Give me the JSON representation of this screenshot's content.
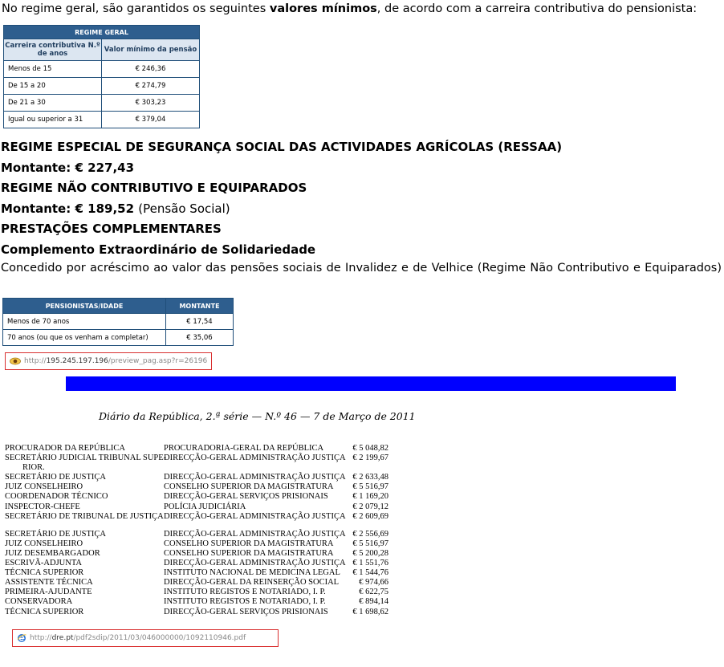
{
  "intro": {
    "before": "No regime geral, são garantidos os seguintes ",
    "bold": "valores mínimos",
    "after": ", de acordo com a carreira contributiva do pensionista:"
  },
  "table1": {
    "caption": "REGIME GERAL",
    "col1": "Carreira contributiva N.º de anos",
    "col2": "Valor mínimo da pensão",
    "rows": [
      {
        "years": "Menos de 15",
        "value": "€ 246,36"
      },
      {
        "years": "De 15 a 20",
        "value": "€ 274,79"
      },
      {
        "years": "De 21 a 30",
        "value": "€ 303,23"
      },
      {
        "years": "Igual ou superior a 31",
        "value": "€ 379,04"
      }
    ]
  },
  "ressaa": {
    "title": "REGIME ESPECIAL DE SEGURANÇA SOCIAL DAS ACTIVIDADES AGRÍCOLAS (RESSAA)",
    "label": "Montante:",
    "amount": "€ 227,43"
  },
  "nao_contrib": {
    "title": "REGIME NÃO CONTRIBUTIVO E EQUIPARADOS",
    "label": "Montante:",
    "amount": "€ 189,52",
    "note": "(Pensão Social)"
  },
  "prestacoes": {
    "title": "PRESTAÇÕES COMPLEMENTARES",
    "subtitle": "Complemento Extraordinário de Solidariedade",
    "text": "Concedido por acréscimo ao valor das pensões sociais de Invalidez e de Velhice (Regime Não Contributivo e Equiparados)"
  },
  "table2": {
    "col1": "PENSIONISTAS/IDADE",
    "col2": "MONTANTE",
    "rows": [
      {
        "age": "Menos de 70 anos",
        "amount": "€ 17,54"
      },
      {
        "age": "70 anos (ou que os venham a completar)",
        "amount": "€ 35,06"
      }
    ]
  },
  "url1": {
    "scheme": "http://",
    "host": "195.245.197.196",
    "path": "/preview_pag.asp?r=26196",
    "icon": "eye-icon"
  },
  "diario": {
    "title": "Diário da República, 2.ª série — N.º 46 — 7  de  Março  de  2011",
    "group1": [
      {
        "cargo": "PROCURADOR DA REPÚBLICA",
        "orgao": "PROCURADORIA-GERAL DA REPÚBLICA",
        "valor": "€ 5 048,82"
      },
      {
        "cargo": "SECRETÁRIO JUDICIAL TRIBUNAL SUPE-",
        "orgao": "DIRECÇÃO-GERAL ADMINISTRAÇÃO JUSTIÇA",
        "valor": "€ 2 199,67"
      },
      {
        "cargo": "RIOR.",
        "orgao": "",
        "valor": "",
        "cont": true
      },
      {
        "cargo": "SECRETÁRIO DE JUSTIÇA",
        "orgao": "DIRECÇÃO-GERAL ADMINISTRAÇÃO JUSTIÇA",
        "valor": "€ 2 633,48"
      },
      {
        "cargo": "JUIZ CONSELHEIRO",
        "orgao": "CONSELHO SUPERIOR DA MAGISTRATURA",
        "valor": "€ 5 516,97"
      },
      {
        "cargo": "COORDENADOR TÉCNICO",
        "orgao": "DIRECÇÃO-GERAL SERVIÇOS PRISIONAIS",
        "valor": "€ 1 169,20"
      },
      {
        "cargo": "INSPECTOR-CHEFE",
        "orgao": "POLÍCIA JUDICIÁRIA",
        "valor": "€ 2 079,12"
      },
      {
        "cargo": "SECRETÁRIO DE TRIBUNAL DE JUSTIÇA",
        "orgao": "DIRECÇÃO-GERAL ADMINISTRAÇÃO JUSTIÇA",
        "valor": "€ 2 609,69"
      }
    ],
    "group2": [
      {
        "cargo": "SECRETÁRIO DE JUSTIÇA",
        "orgao": "DIRECÇÃO-GERAL ADMINISTRAÇÃO JUSTIÇA",
        "valor": "€ 2 556,69"
      },
      {
        "cargo": "JUIZ CONSELHEIRO",
        "orgao": "CONSELHO SUPERIOR DA MAGISTRATURA",
        "valor": "€ 5 516,97"
      },
      {
        "cargo": "JUIZ DESEMBARGADOR",
        "orgao": "CONSELHO SUPERIOR DA MAGISTRATURA",
        "valor": "€ 5 200,28"
      },
      {
        "cargo": "ESCRIVÃ-ADJUNTA",
        "orgao": "DIRECÇÃO-GERAL ADMINISTRAÇÃO JUSTIÇA",
        "valor": "€ 1 551,76"
      },
      {
        "cargo": "TÉCNICA SUPERIOR",
        "orgao": "INSTITUTO NACIONAL DE MEDICINA LEGAL",
        "valor": "€ 1 544,76"
      },
      {
        "cargo": "ASSISTENTE TÉCNICA",
        "orgao": "DIRECÇÃO-GERAL DA REINSERÇÃO SOCIAL",
        "valor": "€ 974,66"
      },
      {
        "cargo": "PRIMEIRA-AJUDANTE",
        "orgao": "INSTITUTO REGISTOS E NOTARIADO, I. P.",
        "valor": "€ 622,75"
      },
      {
        "cargo": "CONSERVADORA",
        "orgao": "INSTITUTO REGISTOS E NOTARIADO, I. P.",
        "valor": "€ 894,14"
      },
      {
        "cargo": "TÉCNICA SUPERIOR",
        "orgao": "DIRECÇÃO-GERAL SERVIÇOS PRISIONAIS",
        "valor": "€ 1 698,62"
      }
    ]
  },
  "url2": {
    "scheme": "http://",
    "host": "dre.pt",
    "path": "/pdf2sdip/2011/03/046000000/1092110946.pdf",
    "icon": "ie-icon"
  },
  "colors": {
    "table_header": "#2e5e8e",
    "table_subheader": "#dce6f1",
    "blue_bar": "#0000ff",
    "url_border": "#d93030"
  }
}
